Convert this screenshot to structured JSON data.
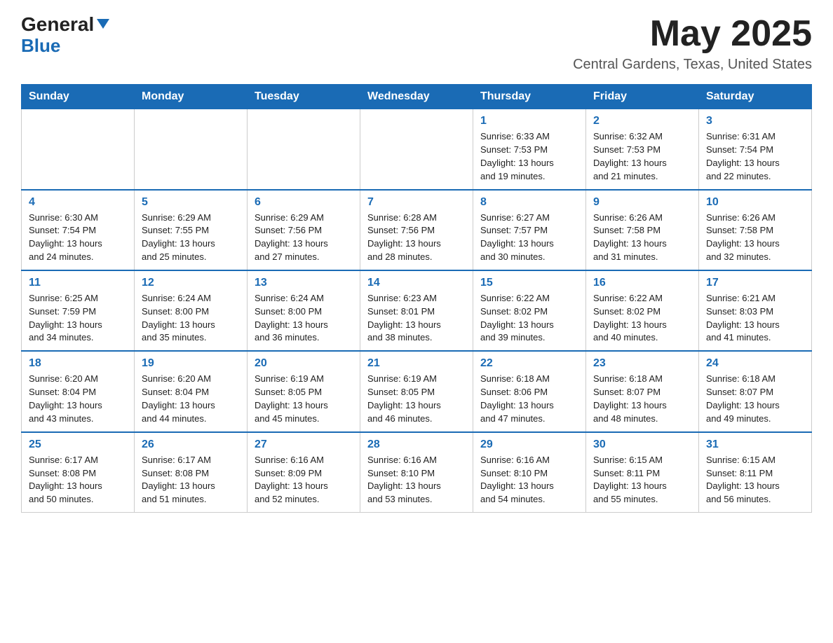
{
  "header": {
    "logo_general": "General",
    "logo_blue": "Blue",
    "month_year": "May 2025",
    "location": "Central Gardens, Texas, United States"
  },
  "days_of_week": [
    "Sunday",
    "Monday",
    "Tuesday",
    "Wednesday",
    "Thursday",
    "Friday",
    "Saturday"
  ],
  "weeks": [
    [
      {
        "day": "",
        "info": ""
      },
      {
        "day": "",
        "info": ""
      },
      {
        "day": "",
        "info": ""
      },
      {
        "day": "",
        "info": ""
      },
      {
        "day": "1",
        "info": "Sunrise: 6:33 AM\nSunset: 7:53 PM\nDaylight: 13 hours\nand 19 minutes."
      },
      {
        "day": "2",
        "info": "Sunrise: 6:32 AM\nSunset: 7:53 PM\nDaylight: 13 hours\nand 21 minutes."
      },
      {
        "day": "3",
        "info": "Sunrise: 6:31 AM\nSunset: 7:54 PM\nDaylight: 13 hours\nand 22 minutes."
      }
    ],
    [
      {
        "day": "4",
        "info": "Sunrise: 6:30 AM\nSunset: 7:54 PM\nDaylight: 13 hours\nand 24 minutes."
      },
      {
        "day": "5",
        "info": "Sunrise: 6:29 AM\nSunset: 7:55 PM\nDaylight: 13 hours\nand 25 minutes."
      },
      {
        "day": "6",
        "info": "Sunrise: 6:29 AM\nSunset: 7:56 PM\nDaylight: 13 hours\nand 27 minutes."
      },
      {
        "day": "7",
        "info": "Sunrise: 6:28 AM\nSunset: 7:56 PM\nDaylight: 13 hours\nand 28 minutes."
      },
      {
        "day": "8",
        "info": "Sunrise: 6:27 AM\nSunset: 7:57 PM\nDaylight: 13 hours\nand 30 minutes."
      },
      {
        "day": "9",
        "info": "Sunrise: 6:26 AM\nSunset: 7:58 PM\nDaylight: 13 hours\nand 31 minutes."
      },
      {
        "day": "10",
        "info": "Sunrise: 6:26 AM\nSunset: 7:58 PM\nDaylight: 13 hours\nand 32 minutes."
      }
    ],
    [
      {
        "day": "11",
        "info": "Sunrise: 6:25 AM\nSunset: 7:59 PM\nDaylight: 13 hours\nand 34 minutes."
      },
      {
        "day": "12",
        "info": "Sunrise: 6:24 AM\nSunset: 8:00 PM\nDaylight: 13 hours\nand 35 minutes."
      },
      {
        "day": "13",
        "info": "Sunrise: 6:24 AM\nSunset: 8:00 PM\nDaylight: 13 hours\nand 36 minutes."
      },
      {
        "day": "14",
        "info": "Sunrise: 6:23 AM\nSunset: 8:01 PM\nDaylight: 13 hours\nand 38 minutes."
      },
      {
        "day": "15",
        "info": "Sunrise: 6:22 AM\nSunset: 8:02 PM\nDaylight: 13 hours\nand 39 minutes."
      },
      {
        "day": "16",
        "info": "Sunrise: 6:22 AM\nSunset: 8:02 PM\nDaylight: 13 hours\nand 40 minutes."
      },
      {
        "day": "17",
        "info": "Sunrise: 6:21 AM\nSunset: 8:03 PM\nDaylight: 13 hours\nand 41 minutes."
      }
    ],
    [
      {
        "day": "18",
        "info": "Sunrise: 6:20 AM\nSunset: 8:04 PM\nDaylight: 13 hours\nand 43 minutes."
      },
      {
        "day": "19",
        "info": "Sunrise: 6:20 AM\nSunset: 8:04 PM\nDaylight: 13 hours\nand 44 minutes."
      },
      {
        "day": "20",
        "info": "Sunrise: 6:19 AM\nSunset: 8:05 PM\nDaylight: 13 hours\nand 45 minutes."
      },
      {
        "day": "21",
        "info": "Sunrise: 6:19 AM\nSunset: 8:05 PM\nDaylight: 13 hours\nand 46 minutes."
      },
      {
        "day": "22",
        "info": "Sunrise: 6:18 AM\nSunset: 8:06 PM\nDaylight: 13 hours\nand 47 minutes."
      },
      {
        "day": "23",
        "info": "Sunrise: 6:18 AM\nSunset: 8:07 PM\nDaylight: 13 hours\nand 48 minutes."
      },
      {
        "day": "24",
        "info": "Sunrise: 6:18 AM\nSunset: 8:07 PM\nDaylight: 13 hours\nand 49 minutes."
      }
    ],
    [
      {
        "day": "25",
        "info": "Sunrise: 6:17 AM\nSunset: 8:08 PM\nDaylight: 13 hours\nand 50 minutes."
      },
      {
        "day": "26",
        "info": "Sunrise: 6:17 AM\nSunset: 8:08 PM\nDaylight: 13 hours\nand 51 minutes."
      },
      {
        "day": "27",
        "info": "Sunrise: 6:16 AM\nSunset: 8:09 PM\nDaylight: 13 hours\nand 52 minutes."
      },
      {
        "day": "28",
        "info": "Sunrise: 6:16 AM\nSunset: 8:10 PM\nDaylight: 13 hours\nand 53 minutes."
      },
      {
        "day": "29",
        "info": "Sunrise: 6:16 AM\nSunset: 8:10 PM\nDaylight: 13 hours\nand 54 minutes."
      },
      {
        "day": "30",
        "info": "Sunrise: 6:15 AM\nSunset: 8:11 PM\nDaylight: 13 hours\nand 55 minutes."
      },
      {
        "day": "31",
        "info": "Sunrise: 6:15 AM\nSunset: 8:11 PM\nDaylight: 13 hours\nand 56 minutes."
      }
    ]
  ]
}
